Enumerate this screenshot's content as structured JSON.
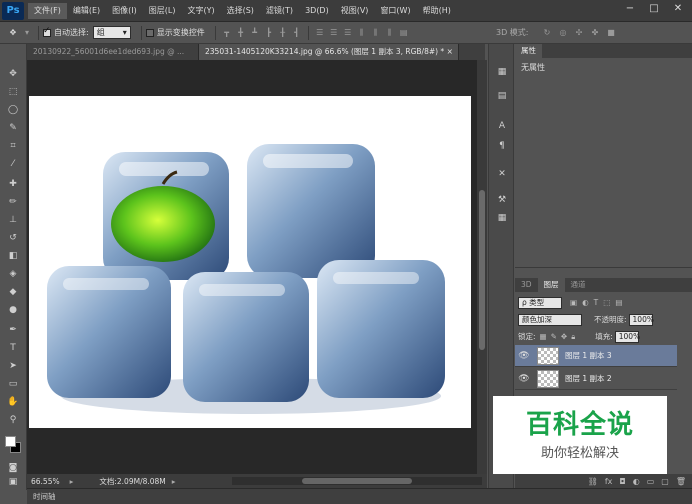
{
  "app": {
    "logo": "Ps"
  },
  "menu": [
    "文件(F)",
    "编辑(E)",
    "图像(I)",
    "图层(L)",
    "文字(Y)",
    "选择(S)",
    "滤镜(T)",
    "3D(D)",
    "视图(V)",
    "窗口(W)",
    "帮助(H)"
  ],
  "window_controls": {
    "minimize": "−",
    "maximize": "□",
    "close": "✕"
  },
  "options": {
    "auto_select_label": "自动选择:",
    "auto_select_value": "组",
    "show_transform_label": "显示变换控件",
    "mode_3d_label": "3D 模式:"
  },
  "tabs": [
    {
      "label": "20130922_56001d6ee1ded693.jpg @ ...",
      "active": false
    },
    {
      "label": "235031-1405120K33214.jpg @ 66.6% (图层 1 副本 3, RGB/8#) * ×",
      "active": true
    }
  ],
  "status": {
    "zoom": "66.55%",
    "doc_info": "文档:2.09M/8.08M"
  },
  "timeline": {
    "label": "时间轴"
  },
  "properties": {
    "tab_label": "属性",
    "body_text": "无属性"
  },
  "layers_panel": {
    "tabs": [
      "3D",
      "图层",
      "通道"
    ],
    "filter_kind": "ρ 类型",
    "blend_mode": "颜色加深",
    "opacity_label": "不透明度:",
    "opacity_value": "100%",
    "lock_label": "锁定:",
    "fill_label": "填充:",
    "fill_value": "100%",
    "layers": [
      {
        "name": "图层 1 副本 3",
        "selected": true
      },
      {
        "name": "图层 1 副本 2",
        "selected": false
      }
    ]
  },
  "watermark": {
    "title": "百科全说",
    "subtitle": "助你轻松解决"
  },
  "colors": {
    "accent_green": "#1aa34a",
    "ps_blue": "#39a6f3",
    "selected_layer": "#6a7b9a"
  }
}
